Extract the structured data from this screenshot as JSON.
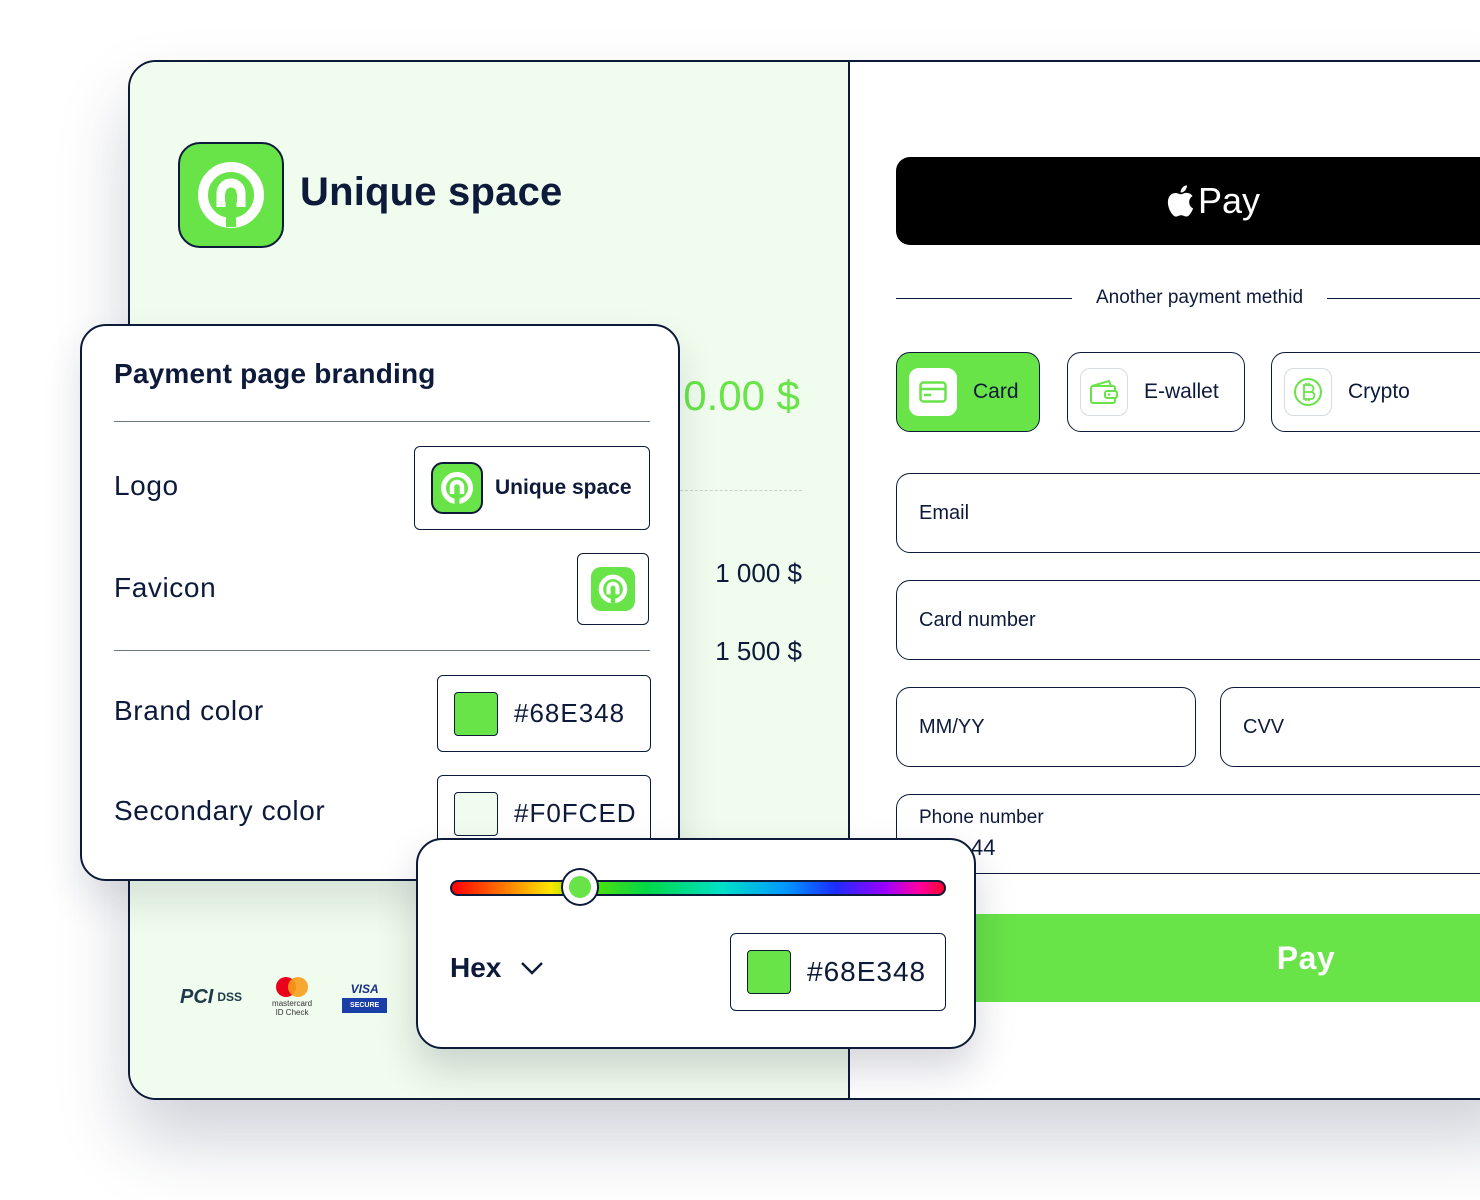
{
  "colors": {
    "brand": "#68E348",
    "secondary": "#F0FCED",
    "ink": "#0D1A3A"
  },
  "checkout": {
    "brand_name": "Unique space",
    "total_partial": "0.00 $",
    "line_items": [
      {
        "amount": "1 000 $"
      },
      {
        "amount": "1 500 $"
      }
    ],
    "apple_pay_label": "Pay",
    "divider_text": "Another payment methid",
    "methods": [
      {
        "label": "Card",
        "icon": "card-icon",
        "active": true
      },
      {
        "label": "E-wallet",
        "icon": "wallet-icon",
        "active": false
      },
      {
        "label": "Crypto",
        "icon": "bitcoin-icon",
        "active": false
      }
    ],
    "fields": {
      "email_placeholder": "Email",
      "card_number_placeholder": "Card number",
      "expiry_placeholder": "MM/YY",
      "cvv_placeholder": "CVV",
      "phone_label": "Phone number",
      "phone_value_visible": "44"
    },
    "pay_button": "Pay",
    "badges": {
      "pci": "PCI",
      "pci_dss": "DSS",
      "mastercard": "mastercard ID Check",
      "visa": "VISA",
      "visa_secure": "SECURE"
    }
  },
  "branding": {
    "title": "Payment page branding",
    "logo_label": "Logo",
    "logo_preview_text": "Unique space",
    "favicon_label": "Favicon",
    "brand_color_label": "Brand color",
    "brand_color_value": "#68E348",
    "secondary_color_label": "Secondary color",
    "secondary_color_value": "#F0FCED"
  },
  "picker": {
    "hue_position": 0.26,
    "format": "Hex",
    "value": "#68E348"
  }
}
